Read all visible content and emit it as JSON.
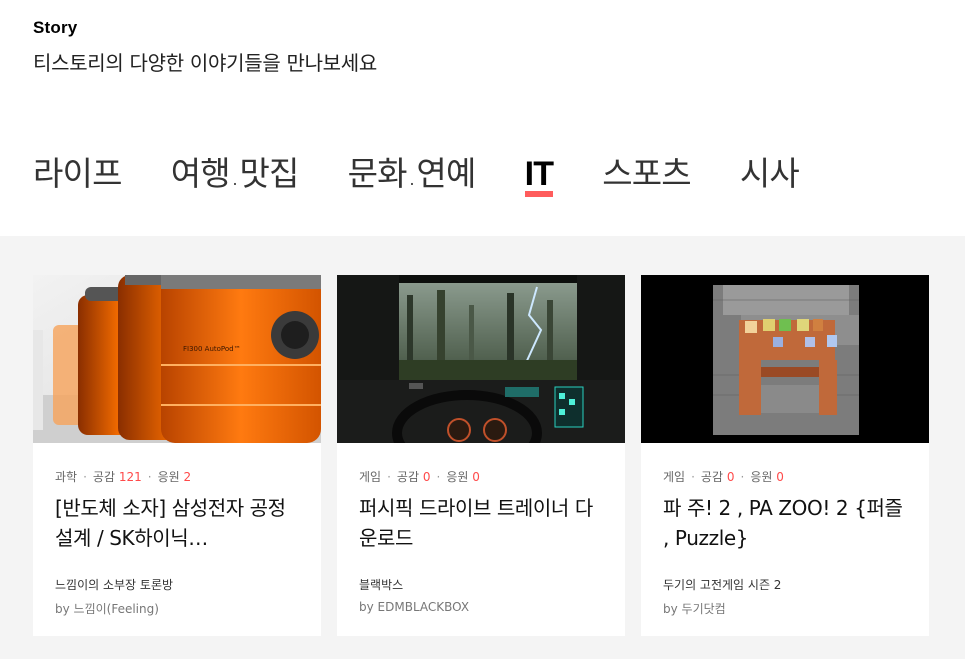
{
  "header": {
    "title": "Story",
    "subtitle": "티스토리의 다양한 이야기들을 만나보세요"
  },
  "tabs": [
    {
      "label": "라이프",
      "active": false
    },
    {
      "label": "여행.맛집",
      "active": false
    },
    {
      "label": "문화.연예",
      "active": false
    },
    {
      "label": "IT",
      "active": true
    },
    {
      "label": "스포츠",
      "active": false
    },
    {
      "label": "시사",
      "active": false
    }
  ],
  "colors": {
    "accent": "#ff4a4a",
    "background_grey": "#f4f4f4"
  },
  "cards": [
    {
      "category": "과학",
      "likes_label": "공감",
      "likes": "121",
      "support_label": "응원",
      "support": "2",
      "title": "[반도체 소자] 삼성전자 공정설계 / SK하이닉…",
      "blog": "느낌이의 소부장 토론방",
      "author": "by 느낌이(Feeling)",
      "thumb_text": "FI300 AutoPod™"
    },
    {
      "category": "게임",
      "likes_label": "공감",
      "likes": "0",
      "support_label": "응원",
      "support": "0",
      "title": "퍼시픽 드라이브 트레이너 다운로드",
      "blog": "블랙박스",
      "author": "by EDMBLACKBOX"
    },
    {
      "category": "게임",
      "likes_label": "공감",
      "likes": "0",
      "support_label": "응원",
      "support": "0",
      "title": "파 주! 2 , PA ZOO! 2 {퍼즐 , Puzzle}",
      "blog": "두기의 고전게임 시즌 2",
      "author": "by 두기닷컴"
    }
  ]
}
